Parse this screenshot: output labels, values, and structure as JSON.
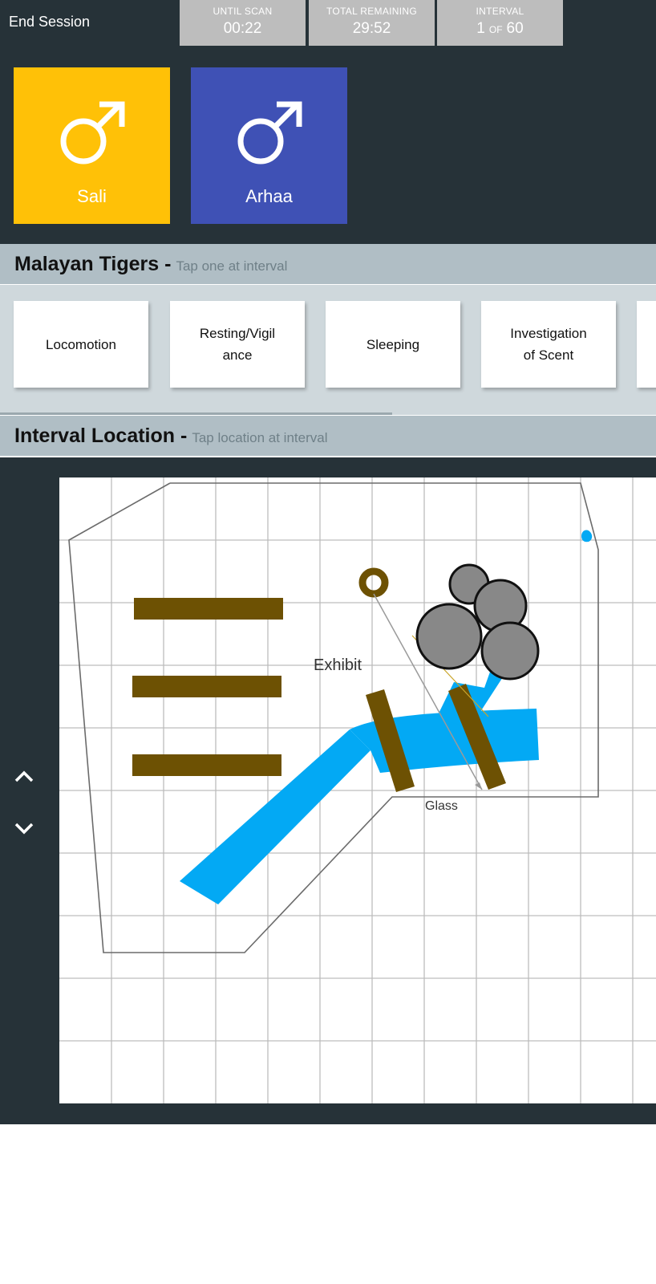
{
  "header": {
    "end_session": "End Session",
    "stats": [
      {
        "label": "UNTIL SCAN",
        "value": "00:22"
      },
      {
        "label": "TOTAL REMAINING",
        "value": "29:52"
      },
      {
        "label": "INTERVAL",
        "current": "1",
        "of": "OF",
        "total": "60"
      }
    ]
  },
  "animals": [
    {
      "name": "Sali",
      "icon": "male-icon",
      "color": "#ffc107"
    },
    {
      "name": "Arhaa",
      "icon": "male-icon",
      "color": "#3f51b5"
    }
  ],
  "behaviors_section": {
    "title": "Malayan Tigers",
    "dash": "-",
    "hint": "Tap one at interval",
    "items": [
      "Locomotion",
      "Resting/Vigil\nance",
      "Sleeping",
      "Investigation\nof Scent",
      ""
    ]
  },
  "location_section": {
    "title": "Interval Location",
    "dash": "-",
    "hint": "Tap location at interval"
  },
  "map": {
    "labels": {
      "exhibit": "Exhibit",
      "glass": "Glass"
    },
    "colors": {
      "water": "#03a9f4",
      "log": "#6d5103",
      "rock": "#888888",
      "grid": "#bdbdbd"
    }
  },
  "nav": {
    "up_icon": "chevron-up-icon",
    "down_icon": "chevron-down-icon"
  }
}
